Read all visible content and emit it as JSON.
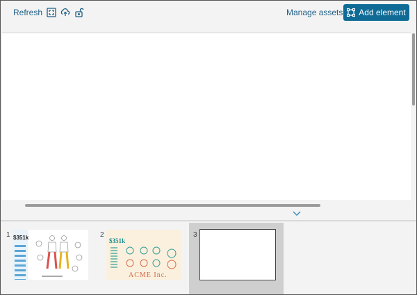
{
  "toolbar": {
    "refresh_label": "Refresh",
    "manage_assets_label": "Manage assets",
    "add_element_label": "Add element",
    "icons": [
      "fit-screen-icon",
      "upload-icon",
      "unlock-icon",
      "add-element-icon"
    ]
  },
  "colors": {
    "accent": "#0f6b96",
    "link": "#1f5f85",
    "background": "#f3f3f3",
    "selected_slide": "#cfcfcf"
  },
  "slides": [
    {
      "number": "1",
      "price_label": "$351k",
      "selected": false
    },
    {
      "number": "2",
      "price_label": "$351k",
      "brand": "ACME Inc.",
      "selected": false
    },
    {
      "number": "3",
      "selected": true
    }
  ]
}
